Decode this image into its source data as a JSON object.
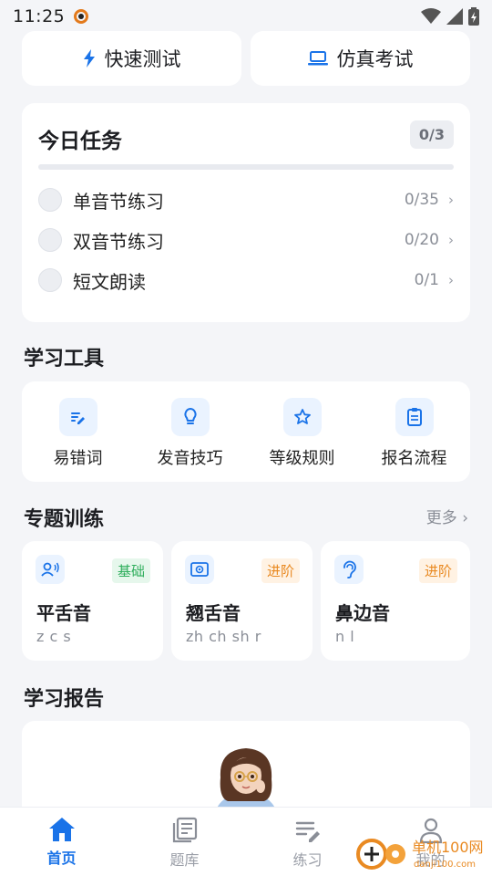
{
  "status_bar": {
    "time": "11:25"
  },
  "quick_actions": [
    {
      "label": "快速测试",
      "icon": "lightning-icon"
    },
    {
      "label": "仿真考试",
      "icon": "laptop-icon"
    }
  ],
  "tasks": {
    "title": "今日任务",
    "count": "0/3",
    "progress": 0,
    "items": [
      {
        "label": "单音节练习",
        "count": "0/35"
      },
      {
        "label": "双音节练习",
        "count": "0/20"
      },
      {
        "label": "短文朗读",
        "count": "0/1"
      }
    ]
  },
  "tools": {
    "title": "学习工具",
    "items": [
      {
        "label": "易错词",
        "icon": "edit-list-icon"
      },
      {
        "label": "发音技巧",
        "icon": "lightbulb-icon"
      },
      {
        "label": "等级规则",
        "icon": "star-icon"
      },
      {
        "label": "报名流程",
        "icon": "clipboard-icon"
      }
    ]
  },
  "topics": {
    "title": "专题训练",
    "more": "更多 ›",
    "items": [
      {
        "name": "平舌音",
        "sub": "z c s",
        "badge": "基础",
        "icon": "voice-icon"
      },
      {
        "name": "翘舌音",
        "sub": "zh ch sh r",
        "badge": "进阶",
        "icon": "target-icon"
      },
      {
        "name": "鼻边音",
        "sub": "n l",
        "badge": "进阶",
        "icon": "ear-icon"
      }
    ]
  },
  "report": {
    "title": "学习报告"
  },
  "nav": [
    {
      "label": "首页",
      "icon": "home-icon",
      "active": true
    },
    {
      "label": "题库",
      "icon": "library-icon",
      "active": false
    },
    {
      "label": "练习",
      "icon": "practice-icon",
      "active": false
    },
    {
      "label": "我的",
      "icon": "profile-icon",
      "active": false
    }
  ],
  "colors": {
    "accent": "#1a73e8",
    "badge_basic": "#2fae5c",
    "badge_advanced": "#e98a22",
    "background": "#f4f5f8"
  },
  "watermark": {
    "text": "单机100网",
    "url_text": "danji100.com"
  }
}
